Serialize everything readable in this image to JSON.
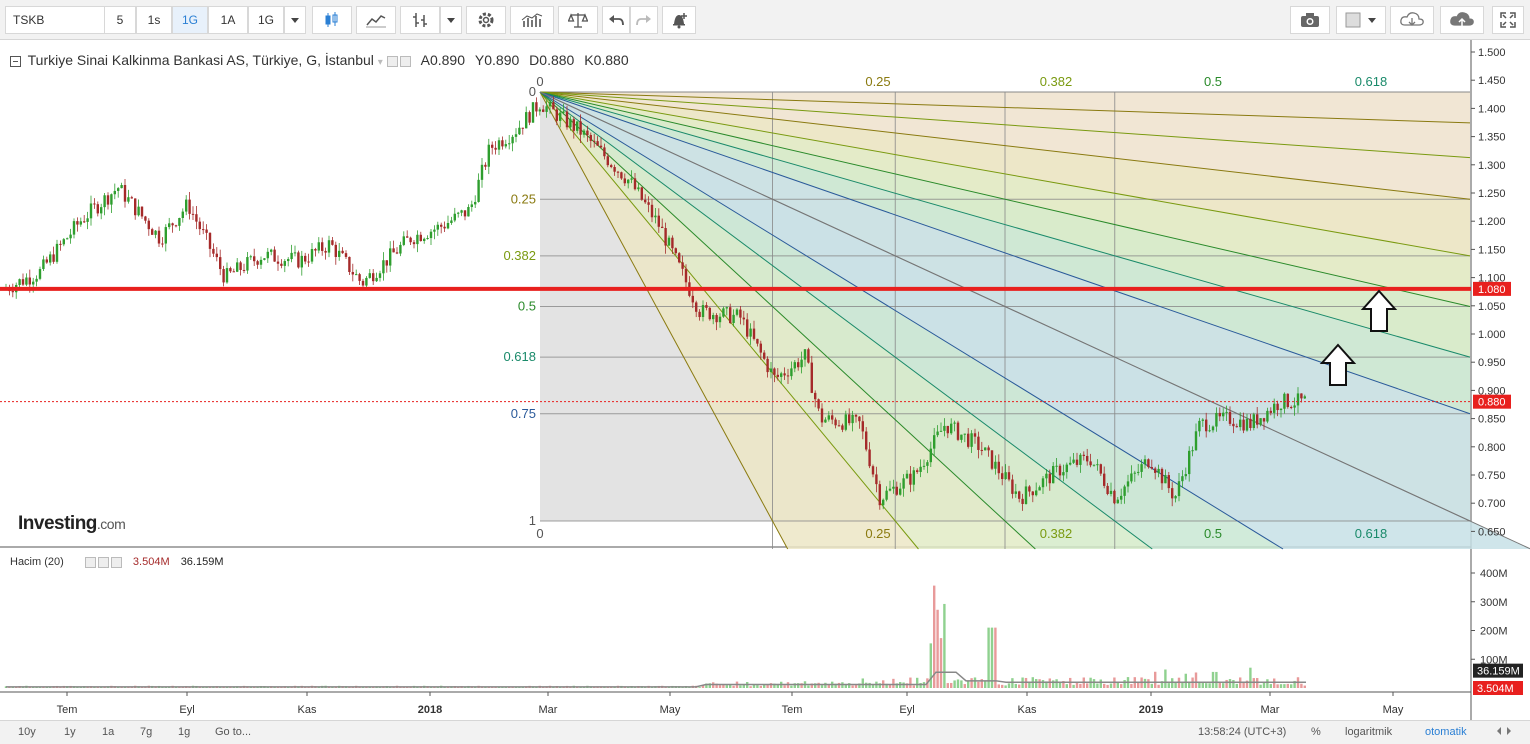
{
  "toolbar": {
    "symbol": "TSKB",
    "intervals": [
      "5",
      "1s",
      "1G",
      "1A",
      "1G"
    ],
    "active_interval_index": 2
  },
  "legend": {
    "title": "Turkiye Sinai Kalkinma Bankasi AS, Türkiye, G, İstanbul",
    "ohlc": [
      {
        "k": "A",
        "v": "0.890"
      },
      {
        "k": "Y",
        "v": "0.890"
      },
      {
        "k": "D",
        "v": "0.880"
      },
      {
        "k": "K",
        "v": "0.880"
      }
    ]
  },
  "volume_legend": {
    "label": "Hacim (20)",
    "value1": "3.504M",
    "value2": "36.159M"
  },
  "watermark": {
    "brand": "Investing",
    "suffix": ".com"
  },
  "price_axis": {
    "ticks": [
      "1.500",
      "1.450",
      "1.400",
      "1.350",
      "1.300",
      "1.250",
      "1.200",
      "1.150",
      "1.100",
      "1.050",
      "1.000",
      "0.950",
      "0.900",
      "0.850",
      "0.800",
      "0.750",
      "0.700",
      "0.650"
    ],
    "current_price": "0.880",
    "resistance_price": "1.080"
  },
  "volume_axis": {
    "ticks": [
      "400M",
      "300M",
      "200M",
      "100M"
    ],
    "ma_value": "36.159M",
    "current_value": "3.504M"
  },
  "time_axis": [
    "Tem",
    "Eyl",
    "Kas",
    "2018",
    "Mar",
    "May",
    "Tem",
    "Eyl",
    "Kas",
    "2019",
    "Mar",
    "May"
  ],
  "fib": {
    "price_levels": [
      {
        "label": "0",
        "color": "#555555"
      },
      {
        "label": "0.25",
        "color": "#8a7a10"
      },
      {
        "label": "0.382",
        "color": "#7a9a10"
      },
      {
        "label": "0.5",
        "color": "#2a8a2a"
      },
      {
        "label": "0.618",
        "color": "#1a8a6a"
      },
      {
        "label": "0.75",
        "color": "#2a5a9a"
      },
      {
        "label": "1",
        "color": "#555555"
      }
    ],
    "time_levels": [
      {
        "label": "0",
        "color": "#555555"
      },
      {
        "label": "0.25",
        "color": "#8a7a10"
      },
      {
        "label": "0.382",
        "color": "#7a9a10"
      },
      {
        "label": "0.5",
        "color": "#2a8a2a"
      },
      {
        "label": "0.618",
        "color": "#1a8a6a"
      }
    ]
  },
  "colors": {
    "up": "#2e9e2e",
    "down": "#a52a2a",
    "resistance": "#e8201e",
    "current": "#e8201e"
  },
  "bottombar": {
    "ranges": [
      "10y",
      "1y",
      "1a",
      "7g",
      "1g"
    ],
    "goto": "Go to...",
    "time": "13:58:24 (UTC+3)",
    "percent": "%",
    "log": "logaritmik",
    "auto": "otomatik"
  }
}
